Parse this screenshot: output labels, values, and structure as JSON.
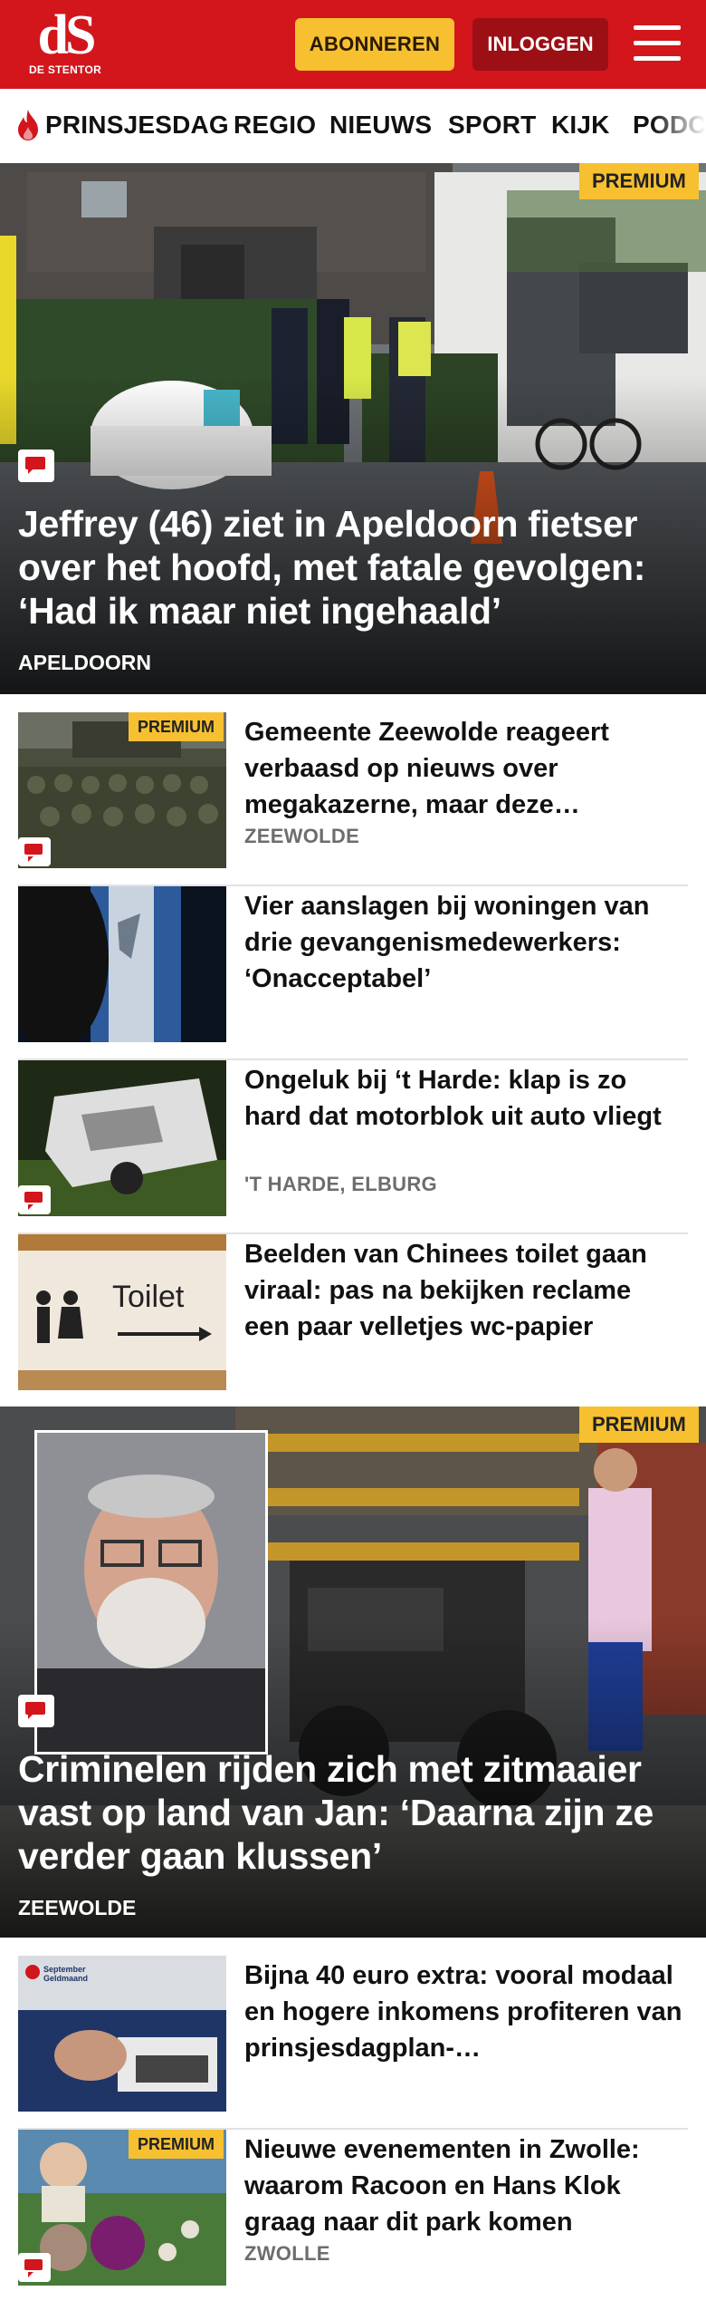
{
  "header": {
    "logo_mark": "dS",
    "logo_sub": "DE STENTOR",
    "subscribe_label": "ABONNEREN",
    "login_label": "INLOGGEN",
    "menu_icon": "hamburger-menu-icon"
  },
  "nav": {
    "items": [
      "PRINSJESDAG",
      "REGIO",
      "NIEUWS",
      "SPORT",
      "KIJK",
      "PODCA"
    ],
    "flame_icon": "flame-icon"
  },
  "colors": {
    "brand_red": "#d2161c",
    "dark_red": "#9c0f14",
    "premium_yellow": "#f6c031",
    "location_gray": "#6d6d6d"
  },
  "articles": {
    "hero1": {
      "badge": "PREMIUM",
      "title": "Jeffrey (46) ziet in Apeldoorn fietser over het hoofd, met fatale gevolgen: ‘Had ik maar niet ingehaald’",
      "location": "APELDOORN",
      "comment_icon": "comment-icon"
    },
    "list1": [
      {
        "badge": "PREMIUM",
        "title": "Gemeente Zeewolde reageert verbaasd op nieuws over megakazerne, maar deze…",
        "location": "ZEEWOLDE"
      },
      {
        "title": "Vier aanslagen bij woningen van drie gevangenismedewerkers: ‘Onacceptabel’"
      },
      {
        "title": "Ongeluk bij ‘t Harde: klap is zo hard dat motorblok uit auto vliegt",
        "location": "'T HARDE, ELBURG"
      },
      {
        "title": "Beelden van Chinees toilet gaan viraal: pas na bekijken reclame een paar velletjes wc-papier",
        "thumb_text": "Toilet"
      }
    ],
    "hero2": {
      "badge": "PREMIUM",
      "title": "Criminelen rijden zich met zitmaaier vast op land van Jan: ‘Daarna zijn ze verder gaan klussen’",
      "location": "ZEEWOLDE"
    },
    "list2": [
      {
        "title": "Bijna 40 euro extra: vooral modaal en hogere inkomens profiteren van prinsjesdagplan-…",
        "thumb_text": "September Geldmaand"
      },
      {
        "badge": "PREMIUM",
        "title": "Nieuwe evenementen in Zwolle: waarom Racoon en Hans Klok graag naar dit park komen",
        "location": "ZWOLLE"
      }
    ]
  }
}
